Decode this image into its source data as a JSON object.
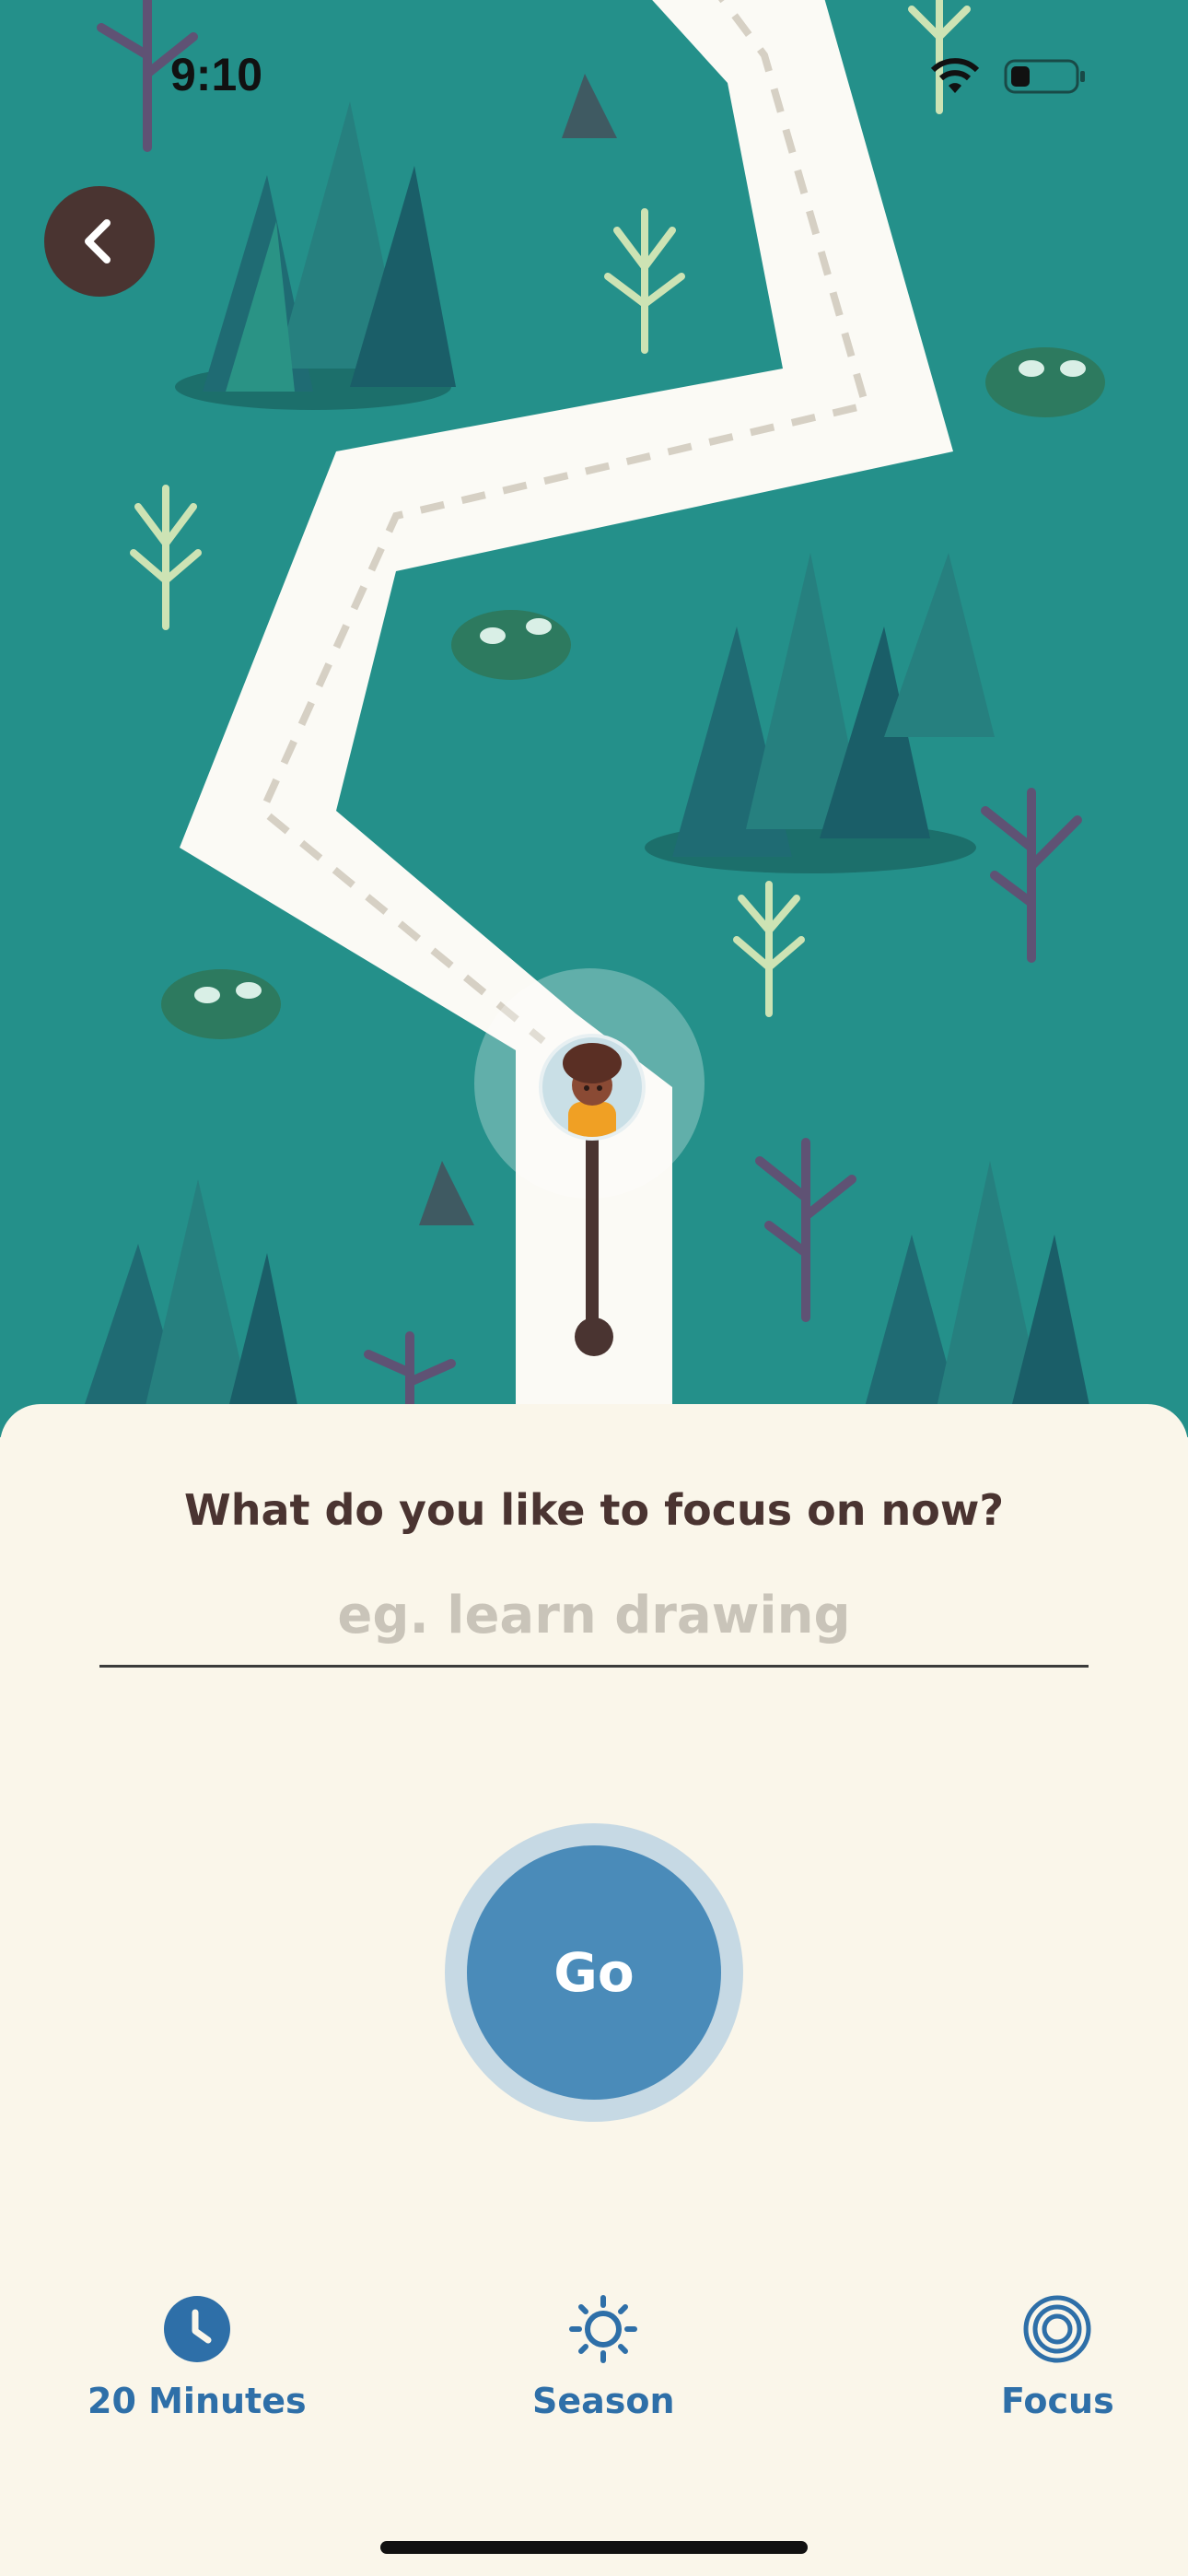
{
  "status_bar": {
    "time": "9:10",
    "wifi_icon": "wifi-icon",
    "battery_icon": "battery-icon"
  },
  "navigation": {
    "back_icon": "chevron-left-icon"
  },
  "map": {
    "scene": "forest-path",
    "avatar_icon": "character-avatar"
  },
  "focus_form": {
    "prompt": "What do you like to focus on now?",
    "placeholder": "eg. learn drawing",
    "value": ""
  },
  "go_button": {
    "label": "Go"
  },
  "tab_bar": {
    "items": [
      {
        "label": "20 Minutes",
        "icon": "clock-icon"
      },
      {
        "label": "Season",
        "icon": "sun-icon"
      },
      {
        "label": "Focus",
        "icon": "target-rings-icon"
      }
    ]
  },
  "colors": {
    "map_background": "#24908a",
    "sheet_background": "#faf6ea",
    "accent_blue": "#2e6fa8",
    "go_button": "#4a8bb9",
    "dark_brown": "#4a3431"
  }
}
